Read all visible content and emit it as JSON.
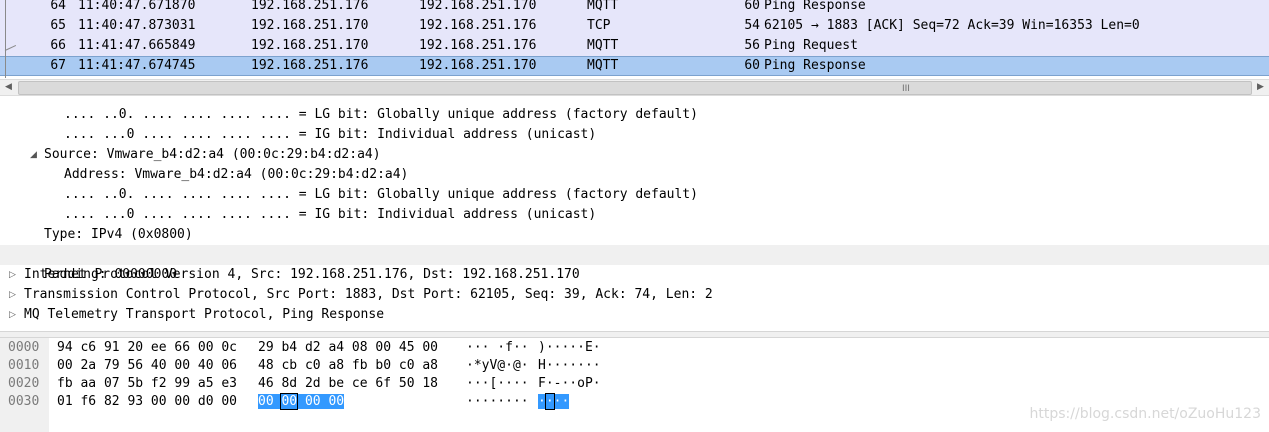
{
  "packet_list": {
    "rows": [
      {
        "no": "64",
        "time": "11:40:47.671870",
        "source": "192.168.251.176",
        "destination": "192.168.251.170",
        "protocol": "MQTT",
        "length": "60",
        "info": "Ping Response"
      },
      {
        "no": "65",
        "time": "11:40:47.873031",
        "source": "192.168.251.170",
        "destination": "192.168.251.176",
        "protocol": "TCP",
        "length": "54",
        "info": "62105 → 1883 [ACK] Seq=72 Ack=39 Win=16353 Len=0"
      },
      {
        "no": "66",
        "time": "11:41:47.665849",
        "source": "192.168.251.170",
        "destination": "192.168.251.176",
        "protocol": "MQTT",
        "length": "56",
        "info": "Ping Request"
      },
      {
        "no": "67",
        "time": "11:41:47.674745",
        "source": "192.168.251.176",
        "destination": "192.168.251.170",
        "protocol": "MQTT",
        "length": "60",
        "info": "Ping Response"
      }
    ],
    "selected_index": 3
  },
  "scrollbar": {
    "grip": "III",
    "left_arrow": "◀",
    "right_arrow": "▶"
  },
  "details": {
    "lines": [
      ".... ..0. .... .... .... .... = LG bit: Globally unique address (factory default)",
      ".... ...0 .... .... .... .... = IG bit: Individual address (unicast)",
      "Source: Vmware_b4:d2:a4 (00:0c:29:b4:d2:a4)",
      "Address: Vmware_b4:d2:a4 (00:0c:29:b4:d2:a4)",
      ".... ..0. .... .... .... .... = LG bit: Globally unique address (factory default)",
      ".... ...0 .... .... .... .... = IG bit: Individual address (unicast)",
      "Type: IPv4 (0x0800)",
      "Padding: 00000000",
      "Internet Protocol Version 4, Src: 192.168.251.176, Dst: 192.168.251.170",
      "Transmission Control Protocol, Src Port: 1883, Dst Port: 62105, Seq: 39, Ack: 74, Len: 2",
      "MQ Telemetry Transport Protocol, Ping Response"
    ]
  },
  "hex": {
    "rows": [
      {
        "offset": "0000",
        "hex_a": "94 c6 91 20 ee 66 00 0c",
        "hex_b": "29 b4 d2 a4 08 00 45 00",
        "ascii_a": "··· ·f··",
        "ascii_b": ")·····E·"
      },
      {
        "offset": "0010",
        "hex_a": "00 2a 79 56 40 00 40 06",
        "hex_b": "48 cb c0 a8 fb b0 c0 a8",
        "ascii_a": "·*yV@·@·",
        "ascii_b": "H·······"
      },
      {
        "offset": "0020",
        "hex_a": "fb aa 07 5b f2 99 a5 e3",
        "hex_b": "46 8d 2d be ce 6f 50 18",
        "ascii_a": "···[····",
        "ascii_b": "F·-··oP·"
      },
      {
        "offset": "0030",
        "hex_a": "01 f6 82 93 00 00 d0 00",
        "hex_b": "",
        "ascii_a": "········",
        "ascii_b": ""
      }
    ],
    "selected": {
      "hex_pre": "00 ",
      "hex_cur": "00",
      "hex_post": " 00 00",
      "ascii_pre": "·",
      "ascii_cur": "·",
      "ascii_post": "··"
    }
  },
  "watermark": "https://blog.csdn.net/oZuoHu123"
}
